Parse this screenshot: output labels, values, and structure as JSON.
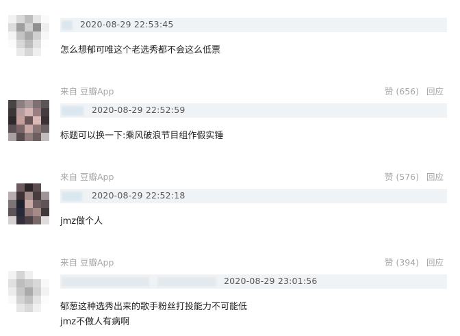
{
  "comments": [
    {
      "timestamp": "2020-08-29 22:53:45",
      "text_lines": [
        "怎么想郁可唯这个老选秀都不会这么低票"
      ],
      "source": "来自 豆瓣App",
      "like_label": "赞 (656)",
      "reply_label": "回应"
    },
    {
      "timestamp": "2020-08-29 22:52:59",
      "text_lines": [
        "标题可以换一下:乘风破浪节目组作假实锤"
      ],
      "source": "来自 豆瓣App",
      "like_label": "赞 (576)",
      "reply_label": "回应"
    },
    {
      "timestamp": "2020-08-29 22:52:18",
      "text_lines": [
        "jmz做个人"
      ],
      "source": "来自 豆瓣App",
      "like_label": "赞 (394)",
      "reply_label": "回应"
    },
    {
      "timestamp": "2020-08-29 23:01:56",
      "text_lines": [
        "郁葱这种选秀出来的歌手粉丝打投能力不可能低",
        "jmz不做人有病啊"
      ]
    }
  ],
  "colors": {
    "header_bar": "#f0f3f5",
    "meta_text": "#a6a6a6",
    "body_text": "#222222"
  }
}
